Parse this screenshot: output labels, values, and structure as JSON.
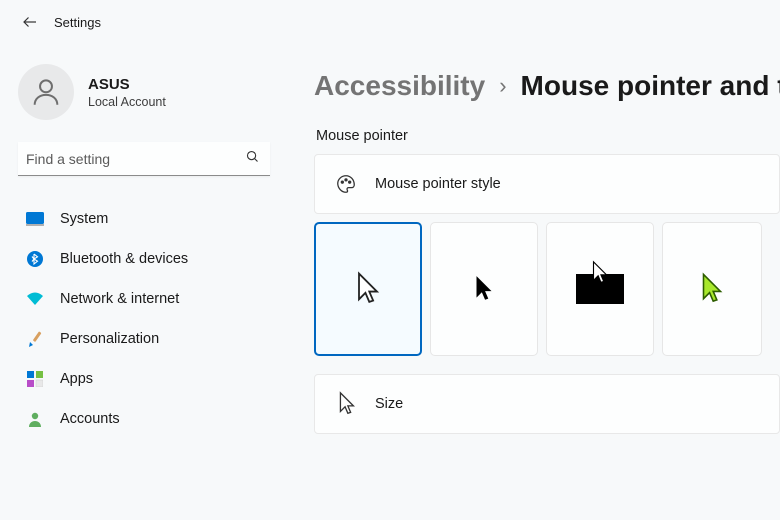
{
  "app_title": "Settings",
  "profile": {
    "name": "ASUS",
    "subtitle": "Local Account"
  },
  "search": {
    "placeholder": "Find a setting"
  },
  "nav": {
    "items": [
      {
        "label": "System"
      },
      {
        "label": "Bluetooth & devices"
      },
      {
        "label": "Network & internet"
      },
      {
        "label": "Personalization"
      },
      {
        "label": "Apps"
      },
      {
        "label": "Accounts"
      }
    ]
  },
  "breadcrumb": {
    "parent": "Accessibility",
    "separator": "›",
    "current": "Mouse pointer and touch"
  },
  "main": {
    "section_label": "Mouse pointer",
    "style_card_title": "Mouse pointer style",
    "size_card_title": "Size"
  }
}
